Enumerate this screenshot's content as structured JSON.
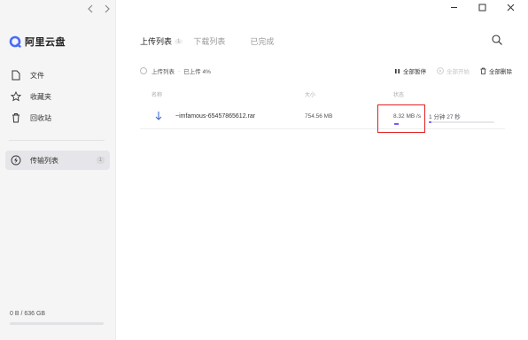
{
  "app": {
    "name": "阿里云盘",
    "accent_color": "#6b5cff",
    "highlight_color": "#e02020"
  },
  "titlebar": {
    "back_icon": "chevron-left-icon",
    "forward_icon": "chevron-right-icon",
    "minimize_icon": "minimize-icon",
    "maximize_icon": "maximize-icon",
    "close_icon": "close-icon"
  },
  "sidebar": {
    "items": [
      {
        "label": "文件",
        "icon": "file-icon"
      },
      {
        "label": "收藏夹",
        "icon": "star-icon"
      },
      {
        "label": "回收站",
        "icon": "trash-icon"
      }
    ],
    "transfer": {
      "label": "传输列表",
      "icon": "lightning-icon",
      "badge": "1"
    },
    "storage": {
      "text": "0 B / 636 GB",
      "used_fraction": 0
    }
  },
  "tabs": [
    {
      "label": "上传列表",
      "badge": "1",
      "active": true
    },
    {
      "label": "下载列表",
      "active": false
    },
    {
      "label": "已完成",
      "active": false
    }
  ],
  "toolbar": {
    "select_all_label": "上传列表",
    "progress_label": "已上传 4%",
    "actions": [
      {
        "label": "全部暂停",
        "icon": "pause-icon",
        "enabled": true
      },
      {
        "label": "全部开始",
        "icon": "play-icon",
        "enabled": false
      },
      {
        "label": "全部删除",
        "icon": "trash-icon",
        "enabled": true
      }
    ]
  },
  "table": {
    "headers": {
      "name": "名称",
      "size": "大小",
      "status": "状态"
    },
    "rows": [
      {
        "icon": "upload-arrow-icon",
        "name": "~imfamous-65457865612.rar",
        "size": "754.56 MB",
        "speed": "8.32 MB /s",
        "eta": "1 分钟 27 秒",
        "progress": 0.04
      }
    ]
  }
}
